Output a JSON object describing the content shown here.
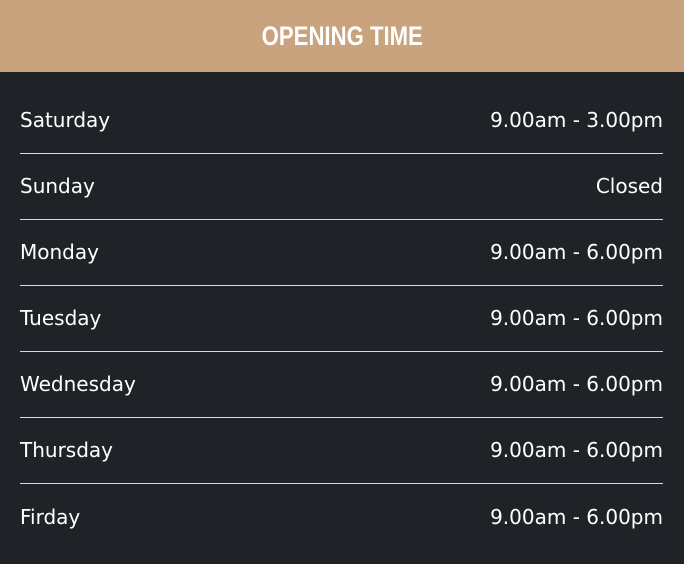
{
  "header": {
    "title": "OPENING TIME"
  },
  "schedule": [
    {
      "day": "Saturday",
      "hours": "9.00am - 3.00pm"
    },
    {
      "day": "Sunday",
      "hours": "Closed"
    },
    {
      "day": "Monday",
      "hours": "9.00am - 6.00pm"
    },
    {
      "day": "Tuesday",
      "hours": "9.00am - 6.00pm"
    },
    {
      "day": "Wednesday",
      "hours": "9.00am - 6.00pm"
    },
    {
      "day": "Thursday",
      "hours": "9.00am - 6.00pm"
    },
    {
      "day": "Firday",
      "hours": "9.00am - 6.00pm"
    }
  ],
  "colors": {
    "header_background": "#c9a27e",
    "panel_background": "#1f2227",
    "text": "#ffffff",
    "divider": "#d9d9d9"
  }
}
